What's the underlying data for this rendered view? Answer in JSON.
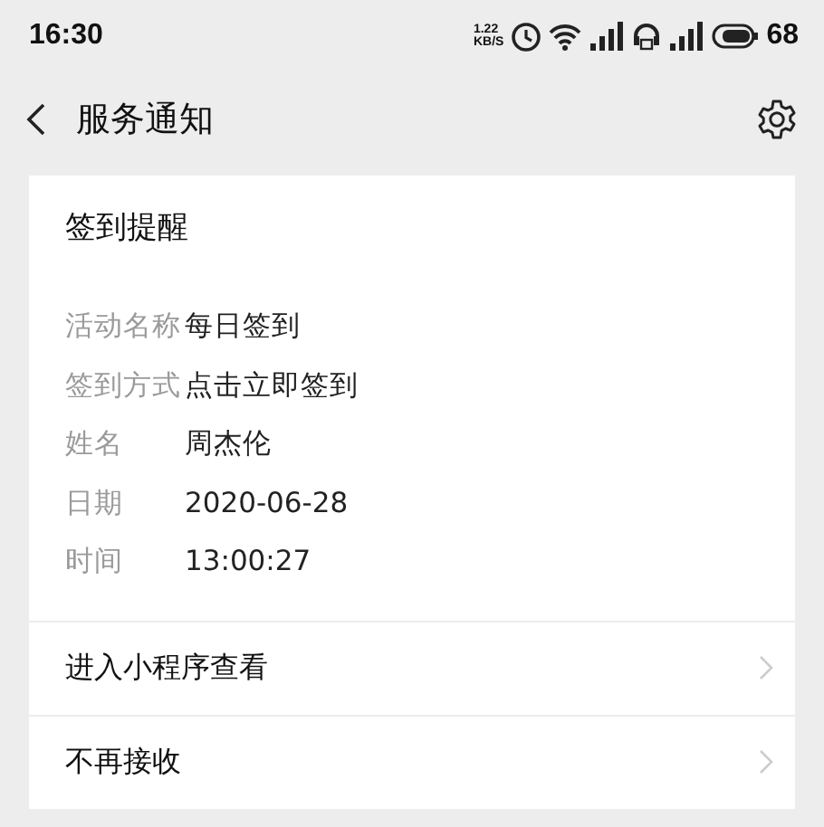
{
  "status_bar": {
    "time": "16:30",
    "net_speed": [
      "1.22",
      "KB/S"
    ],
    "battery": "68"
  },
  "nav": {
    "title": "服务通知"
  },
  "card": {
    "title": "签到提醒",
    "fields": [
      {
        "label": "活动名称",
        "value": "每日签到"
      },
      {
        "label": "签到方式",
        "value": "点击立即签到"
      },
      {
        "label": "姓名",
        "value": "周杰伦"
      },
      {
        "label": "日期",
        "value": "2020-06-28"
      },
      {
        "label": "时间",
        "value": "13:00:27"
      }
    ],
    "actions": [
      "进入小程序查看",
      "不再接收"
    ]
  }
}
